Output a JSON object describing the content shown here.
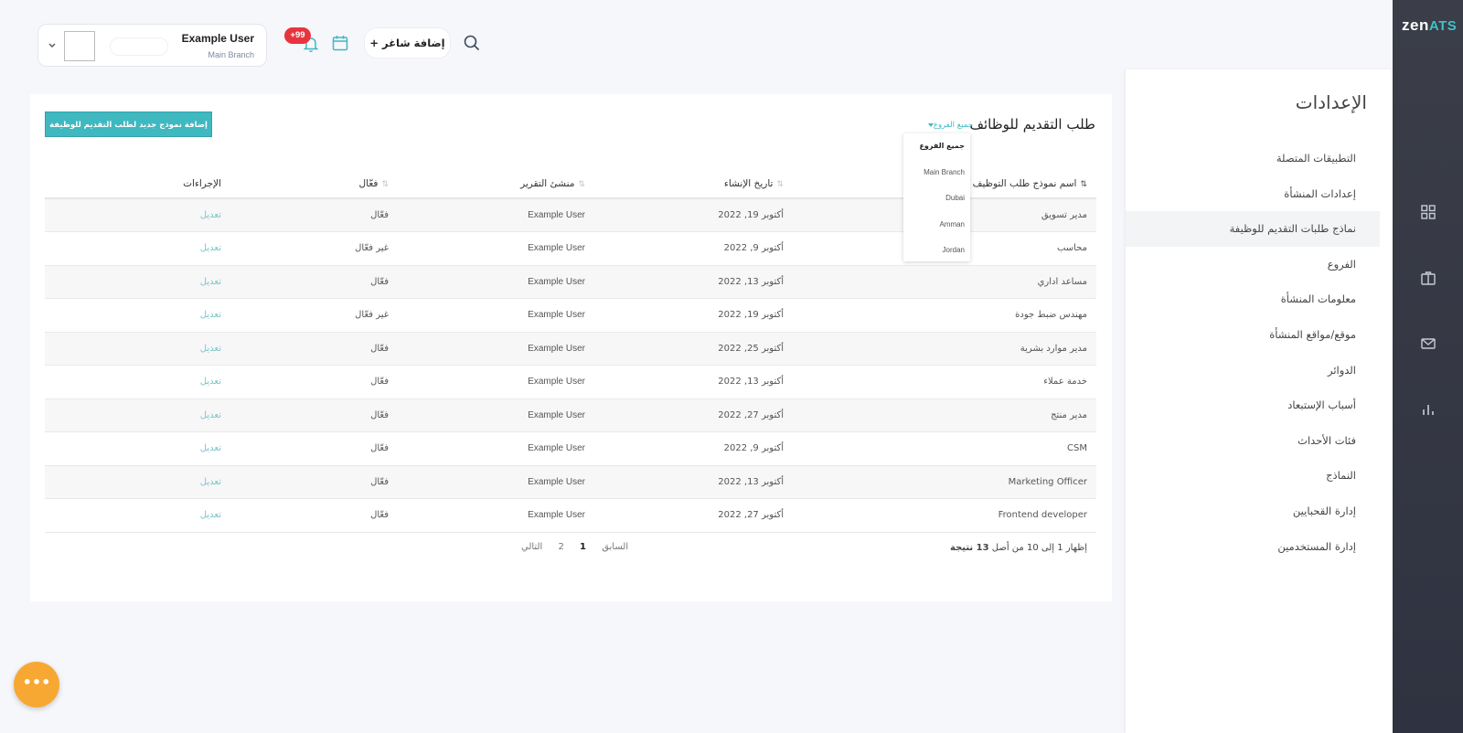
{
  "rail": {
    "logo_main": "zen",
    "logo_accent": "ATS"
  },
  "colors": {
    "accent": "#3fb8bf",
    "rail_bg": "#353845",
    "badge": "#e8343f",
    "fab": "#f7a832"
  },
  "header": {
    "user_name": "Example User",
    "user_branch": "Main Branch",
    "notification_count": "+99",
    "add_job_label": "+ إضافة شاغر"
  },
  "sidebar": {
    "title": "الإعدادات",
    "items": [
      {
        "label": "التطبيقات المتصلة"
      },
      {
        "label": "إعدادات المنشأة"
      },
      {
        "label": "نماذج طلبات التقديم للوظيفة"
      },
      {
        "label": "الفروع"
      },
      {
        "label": "معلومات المنشأة"
      },
      {
        "label": "موقع/مواقع المنشأة"
      },
      {
        "label": "الدوائر"
      },
      {
        "label": "أسباب الإستبعاد"
      },
      {
        "label": "فئات الأحداث"
      },
      {
        "label": "النماذج"
      },
      {
        "label": "إدارة القحبايين"
      },
      {
        "label": "إدارة المستخدمين"
      }
    ]
  },
  "main": {
    "title": "طلب التقديم للوظائف",
    "branch_filter": "جميع الفروع",
    "new_form_button": "إضافة نموذج جديد لطلب التقديم للوظيفة",
    "dropdown": [
      "جميع الفروع",
      "Main Branch",
      "Dubai",
      "Amman",
      "Jordan"
    ],
    "columns": [
      "اسم نموذج طلب التوظيف",
      "تاريخ الإنشاء",
      "منشئ التقرير",
      "فعّال",
      "الإجراءات"
    ],
    "rows": [
      {
        "name": "مدير تسويق",
        "date": "أكتوبر 19, 2022",
        "creator": "Example User",
        "status": "فعّال",
        "action": "تعديل"
      },
      {
        "name": "محاسب",
        "date": "أكتوبر 9, 2022",
        "creator": "Example User",
        "status": "غير فعّال",
        "action": "تعديل"
      },
      {
        "name": "مساعد اداري",
        "date": "أكتوبر 13, 2022",
        "creator": "Example User",
        "status": "فعّال",
        "action": "تعديل"
      },
      {
        "name": "مهندس ضبط جودة",
        "date": "أكتوبر 19, 2022",
        "creator": "Example User",
        "status": "غير فعّال",
        "action": "تعديل"
      },
      {
        "name": "مدير موارد بشرية",
        "date": "أكتوبر 25, 2022",
        "creator": "Example User",
        "status": "فعّال",
        "action": "تعديل"
      },
      {
        "name": "خدمة عملاء",
        "date": "أكتوبر 13, 2022",
        "creator": "Example User",
        "status": "فعّال",
        "action": "تعديل"
      },
      {
        "name": "مدير منتج",
        "date": "أكتوبر 27, 2022",
        "creator": "Example User",
        "status": "فعّال",
        "action": "تعديل"
      },
      {
        "name": "CSM",
        "date": "أكتوبر 9, 2022",
        "creator": "Example User",
        "status": "فعّال",
        "action": "تعديل"
      },
      {
        "name": "Marketing Officer",
        "date": "أكتوبر 13, 2022",
        "creator": "Example User",
        "status": "فعّال",
        "action": "تعديل"
      },
      {
        "name": "Frontend developer",
        "date": "أكتوبر 27, 2022",
        "creator": "Example User",
        "status": "فعّال",
        "action": "تعديل"
      }
    ],
    "summary_prefix": "إظهار 1 إلى 10 من أصل",
    "summary_bold": "13 نتيجة",
    "pager": {
      "prev": "السابق",
      "page1": "1",
      "page2": "2",
      "next": "التالي"
    }
  },
  "fab_label": "•••"
}
